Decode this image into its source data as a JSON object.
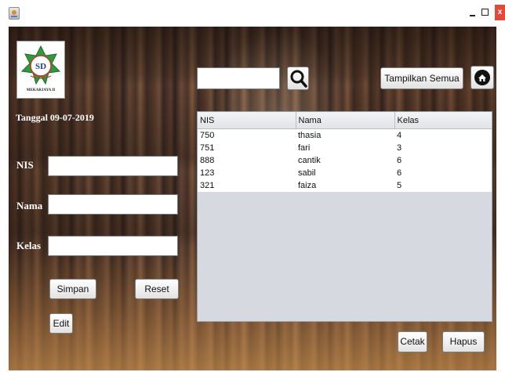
{
  "window": {
    "close_label": "x"
  },
  "sidebar": {
    "date": "Tanggal 09-07-2019",
    "logo_text": "MEKARJAYA II",
    "fields": [
      {
        "label": "NIS",
        "value": ""
      },
      {
        "label": "Nama",
        "value": ""
      },
      {
        "label": "Kelas",
        "value": ""
      }
    ],
    "buttons": {
      "simpan": "Simpan",
      "reset": "Reset",
      "edit": "Edit"
    }
  },
  "toolbar": {
    "search_value": "",
    "search_icon": "search-icon",
    "show_all_label": "Tampilkan Semua",
    "home_icon": "home-icon"
  },
  "table": {
    "columns": [
      "NIS",
      "Nama",
      "Kelas"
    ],
    "rows": [
      [
        "750",
        "thasia",
        "4"
      ],
      [
        "751",
        "fari",
        "3"
      ],
      [
        "888",
        "cantik",
        "6"
      ],
      [
        "123",
        "sabil",
        "6"
      ],
      [
        "321",
        "faiza",
        "5"
      ]
    ]
  },
  "footer": {
    "cetak": "Cetak",
    "hapus": "Hapus"
  },
  "colors": {
    "close_button": "#e04a3d",
    "table_empty": "#d6d9df"
  }
}
